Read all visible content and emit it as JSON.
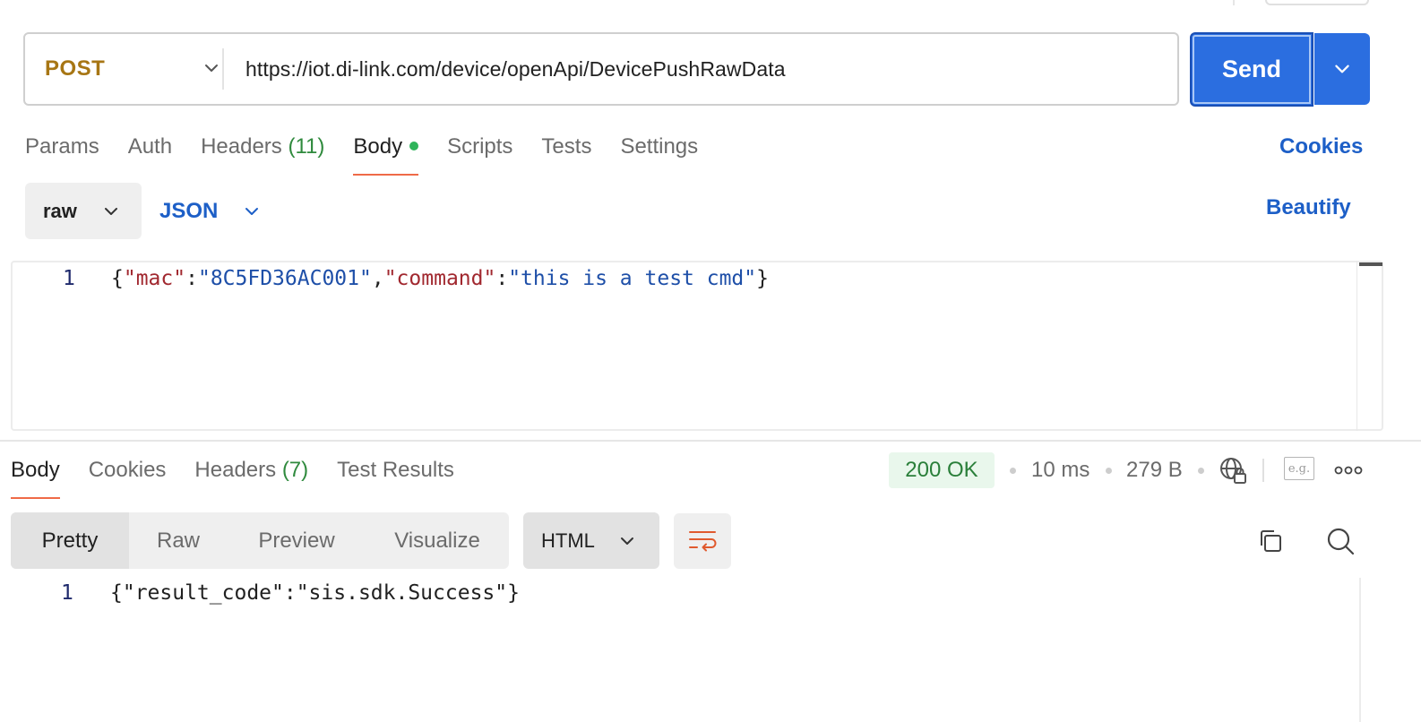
{
  "request": {
    "method": "POST",
    "url": "https://iot.di-link.com/device/openApi/DevicePushRawData",
    "send_label": "Send"
  },
  "request_tabs": {
    "params": "Params",
    "auth": "Auth",
    "headers": "Headers",
    "headers_count": "(11)",
    "body": "Body",
    "scripts": "Scripts",
    "tests": "Tests",
    "settings": "Settings",
    "cookies": "Cookies"
  },
  "body_options": {
    "mode": "raw",
    "language": "JSON",
    "beautify": "Beautify"
  },
  "request_body": {
    "line_number": "1",
    "open": "{",
    "key1": "\"mac\"",
    "colon": ":",
    "val1": "\"8C5FD36AC001\"",
    "comma": ",",
    "key2": "\"command\"",
    "val2": "\"this is a test cmd\"",
    "close": "}"
  },
  "response_tabs": {
    "body": "Body",
    "cookies": "Cookies",
    "headers": "Headers",
    "headers_count": "(7)",
    "test_results": "Test Results"
  },
  "response_meta": {
    "status": "200 OK",
    "time": "10 ms",
    "size": "279 B",
    "example_icon_text": "e.g."
  },
  "response_view": {
    "pretty": "Pretty",
    "raw": "Raw",
    "preview": "Preview",
    "visualize": "Visualize",
    "format": "HTML"
  },
  "response_body": {
    "line_number": "1",
    "text": "{\"result_code\":\"sis.sdk.Success\"}"
  },
  "colors": {
    "accent": "#2b6ee0",
    "method": "#a77614",
    "link": "#1d5fc7",
    "active_tab_underline": "#ef6a47",
    "status_ok": "#2a7f3a"
  }
}
